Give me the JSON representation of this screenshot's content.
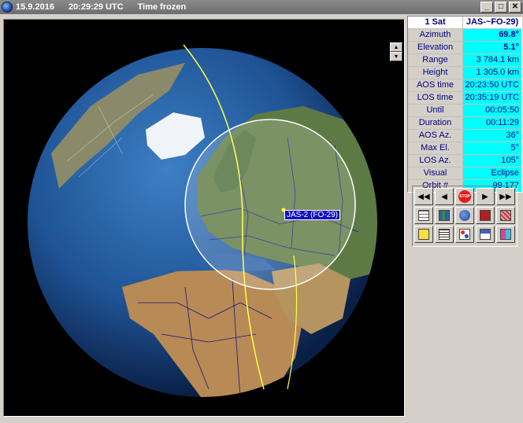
{
  "titlebar": {
    "date": "15.9.2016",
    "time": "20:29:29 UTC",
    "status": "Time frozen",
    "minimize": "_",
    "maximize": "□",
    "close": "✕"
  },
  "view": {
    "sat_label": "JAS-2 (FO-29)",
    "spin_up": "▲",
    "spin_down": "▼"
  },
  "info_table": {
    "header_left": "1 Sat",
    "header_right": "JAS-~FO-29)",
    "rows": [
      {
        "label": "Azimuth",
        "value": "69.8°"
      },
      {
        "label": "Elevation",
        "value": "5.1°"
      },
      {
        "label": "Range",
        "value": "3 784.1 km"
      },
      {
        "label": "Height",
        "value": "1 305.0 km"
      },
      {
        "label": "AOS time",
        "value": "20:23:50 UTC"
      },
      {
        "label": "LOS time",
        "value": "20:35:19 UTC"
      },
      {
        "label": "Until",
        "value": "00:05:50"
      },
      {
        "label": "Duration",
        "value": "00:11:29"
      },
      {
        "label": "AOS Az.",
        "value": "36°"
      },
      {
        "label": "Max El.",
        "value": "5°"
      },
      {
        "label": "LOS Az.",
        "value": "105°"
      },
      {
        "label": "Visual",
        "value": "Eclipse"
      },
      {
        "label": "Orbit #",
        "value": "99 177"
      }
    ]
  },
  "controls": {
    "rewind_fast": "◀◀",
    "rewind": "◀",
    "stop": "STOP",
    "forward": "▶",
    "forward_fast": "▶▶"
  }
}
